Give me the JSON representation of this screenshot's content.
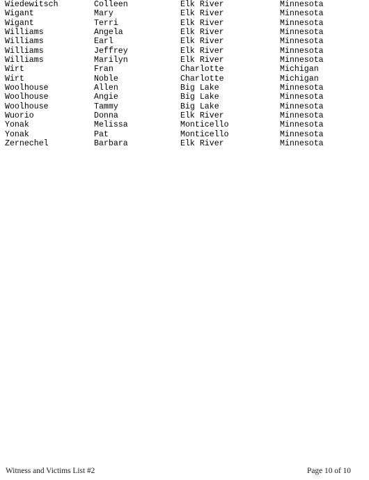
{
  "document": {
    "columns": [
      "last_name",
      "first_name",
      "city",
      "state"
    ],
    "rows": [
      {
        "last_name": "Wiedewitsch",
        "first_name": "Colleen",
        "city": "Elk River",
        "state": "Minnesota"
      },
      {
        "last_name": "Wigant",
        "first_name": "Mary",
        "city": "Elk River",
        "state": "Minnesota"
      },
      {
        "last_name": "Wigant",
        "first_name": "Terri",
        "city": "Elk River",
        "state": "Minnesota"
      },
      {
        "last_name": "Williams",
        "first_name": "Angela",
        "city": "Elk River",
        "state": "Minnesota"
      },
      {
        "last_name": "Williams",
        "first_name": "Earl",
        "city": "Elk River",
        "state": "Minnesota"
      },
      {
        "last_name": "Williams",
        "first_name": "Jeffrey",
        "city": "Elk River",
        "state": "Minnesota"
      },
      {
        "last_name": "Williams",
        "first_name": "Marilyn",
        "city": "Elk River",
        "state": "Minnesota"
      },
      {
        "last_name": "Wirt",
        "first_name": "Fran",
        "city": "Charlotte",
        "state": "Michigan"
      },
      {
        "last_name": "Wirt",
        "first_name": "Noble",
        "city": "Charlotte",
        "state": "Michigan"
      },
      {
        "last_name": "Woolhouse",
        "first_name": "Allen",
        "city": "Big Lake",
        "state": "Minnesota"
      },
      {
        "last_name": "Woolhouse",
        "first_name": "Angie",
        "city": "Big Lake",
        "state": "Minnesota"
      },
      {
        "last_name": "Woolhouse",
        "first_name": "Tammy",
        "city": "Big Lake",
        "state": "Minnesota"
      },
      {
        "last_name": "Wuorio",
        "first_name": "Donna",
        "city": "Elk River",
        "state": "Minnesota"
      },
      {
        "last_name": "Yonak",
        "first_name": "Melissa",
        "city": "Monticello",
        "state": "Minnesota"
      },
      {
        "last_name": "Yonak",
        "first_name": "Pat",
        "city": "Monticello",
        "state": "Minnesota"
      },
      {
        "last_name": "Zernechel",
        "first_name": "Barbara",
        "city": "Elk River",
        "state": "Minnesota"
      }
    ]
  },
  "footer": {
    "title": "Witness and Victims List #2",
    "page_label": "Page 10 of 10"
  }
}
